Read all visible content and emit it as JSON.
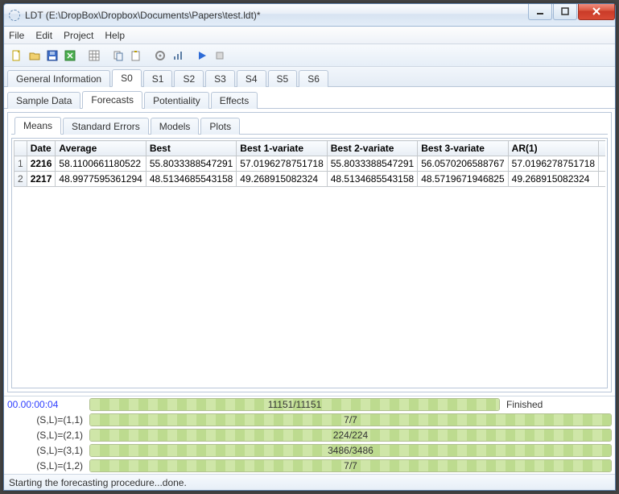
{
  "window": {
    "title": "LDT (E:\\DropBox\\Dropbox\\Documents\\Papers\\test.ldt)*"
  },
  "menu": {
    "file": "File",
    "edit": "Edit",
    "project": "Project",
    "help": "Help"
  },
  "main_tabs": {
    "gi": "General Information",
    "s0": "S0",
    "s1": "S1",
    "s2": "S2",
    "s3": "S3",
    "s4": "S4",
    "s5": "S5",
    "s6": "S6"
  },
  "sub_tabs": {
    "sample": "Sample Data",
    "forecasts": "Forecasts",
    "potentiality": "Potentiality",
    "effects": "Effects"
  },
  "sub2_tabs": {
    "means": "Means",
    "stderr": "Standard Errors",
    "models": "Models",
    "plots": "Plots"
  },
  "grid": {
    "headers": {
      "date": "Date",
      "average": "Average",
      "best": "Best",
      "b1": "Best 1-variate",
      "b2": "Best 2-variate",
      "b3": "Best 3-variate",
      "ar1": "AR(1)"
    },
    "rows": [
      {
        "n": "1",
        "date": "2216",
        "avg": "58.1100661180522",
        "best": "55.8033388547291",
        "b1": "57.0196278751718",
        "b2": "55.8033388547291",
        "b3": "56.0570206588767",
        "ar1": "57.0196278751718"
      },
      {
        "n": "2",
        "date": "2217",
        "avg": "48.9977595361294",
        "best": "48.5134685543158",
        "b1": "49.268915082324",
        "b2": "48.5134685543158",
        "b3": "48.5719671946825",
        "ar1": "49.268915082324"
      }
    ]
  },
  "progress": {
    "main": {
      "time": "00.00:00:04",
      "text": "11151/11151",
      "trail": "Finished"
    },
    "sub": [
      {
        "label": "(S,L)=(1,1)",
        "text": "7/7"
      },
      {
        "label": "(S,L)=(2,1)",
        "text": "224/224"
      },
      {
        "label": "(S,L)=(3,1)",
        "text": "3486/3486"
      },
      {
        "label": "(S,L)=(1,2)",
        "text": "7/7"
      }
    ]
  },
  "status": "Starting the forecasting procedure...done."
}
